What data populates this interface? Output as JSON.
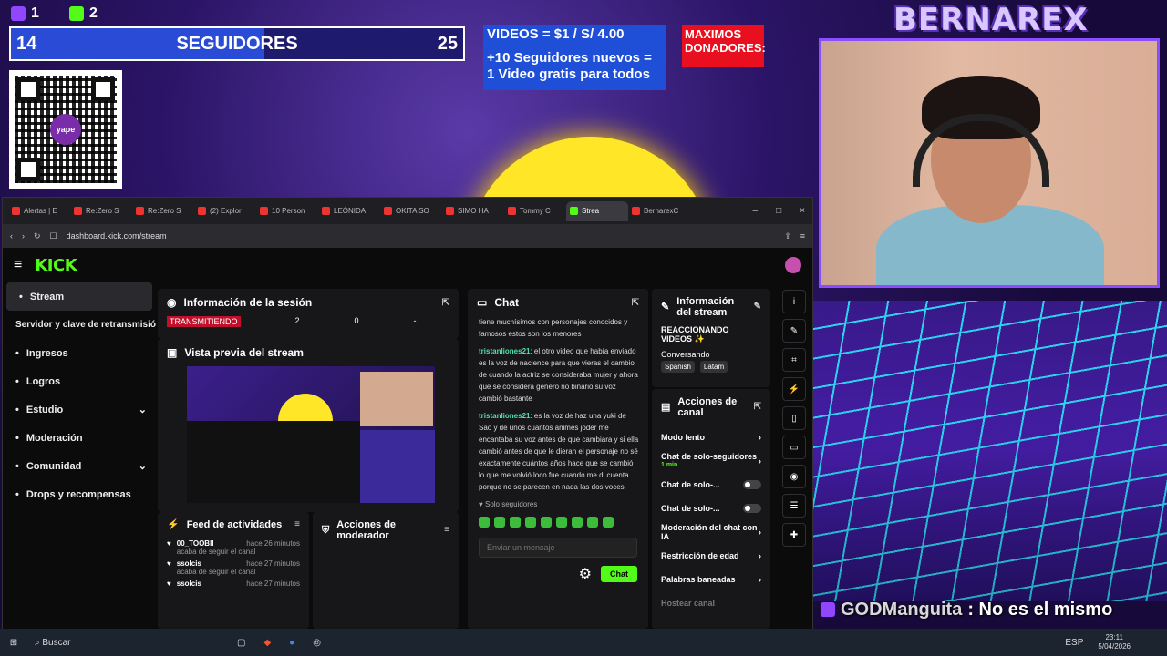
{
  "overlay": {
    "twitch_count": "1",
    "kick_count": "2",
    "followers_current": "14",
    "followers_label": "SEGUIDORES",
    "followers_goal": "25",
    "qr_logo": "yape",
    "promo_line1": "VIDEOS = $1 / S/ 4.00",
    "promo_line2": "+10 Seguidores nuevos = 1 Video gratis para todos",
    "donors": "MAXIMOS DONADORES:",
    "channel_logo": "BERNAREX",
    "chat_user": "GODManguita",
    "chat_text": ": No es el mismo"
  },
  "browser": {
    "tabs": [
      "Alertas | E",
      "Re:Zero S",
      "Re:Zero S",
      "(2) Explor",
      "10 Person",
      "LEÓNIDA",
      "OKITA SO",
      "SIMO HA",
      "Tommy C",
      "Strea",
      "BernarexC"
    ],
    "active_tab_index": 9,
    "url": "dashboard.kick.com/stream"
  },
  "kick": {
    "logo": "KICK",
    "sidebar": [
      {
        "label": "Stream",
        "icon": "broadcast-icon"
      },
      {
        "label": "Servidor y clave de retransmisión",
        "icon": ""
      },
      {
        "label": "Ingresos",
        "icon": "chart-icon"
      },
      {
        "label": "Logros",
        "icon": "trophy-icon"
      },
      {
        "label": "Estudio",
        "icon": "studio-icon"
      },
      {
        "label": "Moderación",
        "icon": "wrench-icon"
      },
      {
        "label": "Comunidad",
        "icon": "community-icon"
      },
      {
        "label": "Drops y recompensas",
        "icon": "gift-icon"
      }
    ],
    "session": {
      "title": "Información de la sesión",
      "status": "TRANSMITIENDO",
      "v1": "2",
      "v2": "0",
      "v3": "-"
    },
    "preview": {
      "title": "Vista previa del stream"
    },
    "feed": {
      "title": "Feed de actividades",
      "items": [
        {
          "user": "00_TOOBII",
          "time": "hace 26 minutos",
          "text": "acaba de seguir el canal"
        },
        {
          "user": "ssolcis",
          "time": "hace 27 minutos",
          "text": "acaba de seguir el canal"
        },
        {
          "user": "ssolcis",
          "time": "hace 27 minutos",
          "text": ""
        }
      ]
    },
    "modactions": {
      "title": "Acciones de moderador"
    },
    "chat": {
      "title": "Chat",
      "msg0": "tiene muchísimos con personajes conocidos y famosos estos son los menores",
      "msgs": [
        {
          "user": "tristanliones21",
          "text": ": el otro video que había enviado es la voz de nacience para que vieras el cambio de cuando la actriz se consideraba mujer y ahora que se considera género no binario su voz cambió bastante"
        },
        {
          "user": "tristanliones21",
          "text": ": es la voz de haz una yuki de Sao y de unos cuantos animes joder me encantaba su voz antes de que cambiara y si ella cambió antes de que le dieran el personaje no sé exactamente cuántos años hace que se cambió lo que me volvió loco fue cuando me di cuenta porque no se parecen en nada las dos voces"
        }
      ],
      "mode": "Solo seguidores",
      "placeholder": "Enviar un mensaje",
      "send": "Chat"
    },
    "streaminfo": {
      "title": "Información del stream",
      "stream_title": "REACCIONANDO VIDEOS ✨",
      "category": "Conversando",
      "tags": [
        "Spanish",
        "Latam"
      ]
    },
    "channel_actions": {
      "title": "Acciones de canal",
      "items": [
        {
          "label": "Modo lento",
          "sub": ""
        },
        {
          "label": "Chat de solo-seguidores",
          "sub": "1 min"
        },
        {
          "label": "Chat de solo-...",
          "sub": ""
        },
        {
          "label": "Chat de solo-...",
          "sub": ""
        },
        {
          "label": "Moderación del chat con IA",
          "sub": ""
        },
        {
          "label": "Restricción de edad",
          "sub": ""
        },
        {
          "label": "Palabras baneadas",
          "sub": ""
        },
        {
          "label": "Hostear canal",
          "sub": ""
        }
      ]
    }
  },
  "taskbar": {
    "search": "Buscar",
    "lang": "ESP",
    "time": "23:11",
    "date": "5/04/2026"
  }
}
